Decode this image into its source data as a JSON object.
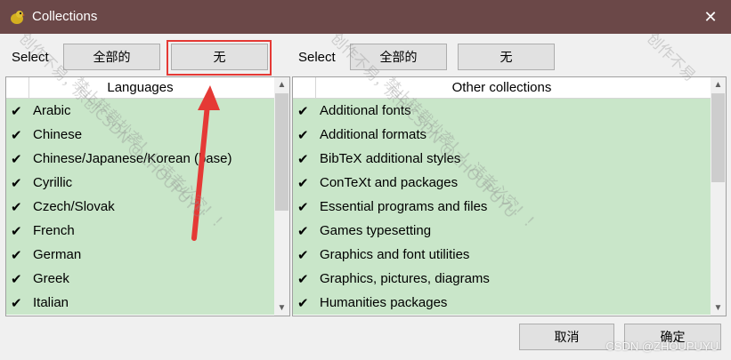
{
  "window": {
    "title": "Collections",
    "close_glyph": "✕"
  },
  "left": {
    "select_label": "Select",
    "all_button": "全部的",
    "none_button": "无",
    "header": "Languages",
    "items": [
      "Arabic",
      "Chinese",
      "Chinese/Japanese/Korean (base)",
      "Cyrillic",
      "Czech/Slovak",
      "French",
      "German",
      "Greek",
      "Italian"
    ]
  },
  "right": {
    "select_label": "Select",
    "all_button": "全部的",
    "none_button": "无",
    "header": "Other collections",
    "items": [
      "Additional fonts",
      "Additional formats",
      "BibTeX additional styles",
      "ConTeXt and packages",
      "Essential programs and files",
      "Games typesetting",
      "Graphics and font utilities",
      "Graphics, pictures, diagrams",
      "Humanities packages"
    ]
  },
  "checkmark": "✔",
  "footer": {
    "cancel": "取消",
    "ok": "确定"
  },
  "watermark": {
    "text1": "创作不易，原创CSDN @ZHOUPUYU",
    "text2": "禁止转载抄袭！！违者必究！！",
    "text3": "创作不易",
    "csdn": "CSDN @ZHOUPUYU"
  },
  "colors": {
    "titlebar": "#6b4848",
    "checked_row": "#c9e6c9",
    "highlight": "#e53935"
  }
}
